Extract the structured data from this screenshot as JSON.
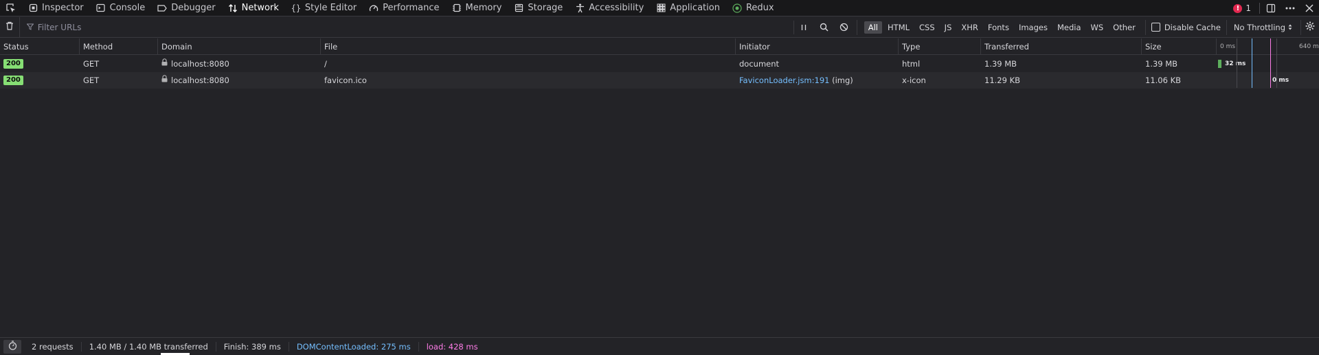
{
  "toolbar": {
    "tabs": [
      {
        "label": "Inspector",
        "icon": "inspector-icon"
      },
      {
        "label": "Console",
        "icon": "console-icon"
      },
      {
        "label": "Debugger",
        "icon": "debugger-icon"
      },
      {
        "label": "Network",
        "icon": "network-icon",
        "active": true
      },
      {
        "label": "Style Editor",
        "icon": "style-editor-icon"
      },
      {
        "label": "Performance",
        "icon": "performance-icon"
      },
      {
        "label": "Memory",
        "icon": "memory-icon"
      },
      {
        "label": "Storage",
        "icon": "storage-icon"
      },
      {
        "label": "Accessibility",
        "icon": "accessibility-icon"
      },
      {
        "label": "Application",
        "icon": "application-icon"
      },
      {
        "label": "Redux",
        "icon": "redux-icon"
      }
    ],
    "error_count": "1"
  },
  "filterbar": {
    "filter_placeholder": "Filter URLs",
    "types": [
      "All",
      "HTML",
      "CSS",
      "JS",
      "XHR",
      "Fonts",
      "Images",
      "Media",
      "WS",
      "Other"
    ],
    "active_type": "All",
    "disable_cache_label": "Disable Cache",
    "throttling_label": "No Throttling"
  },
  "table": {
    "columns": {
      "status": "Status",
      "method": "Method",
      "domain": "Domain",
      "file": "File",
      "initiator": "Initiator",
      "type": "Type",
      "transferred": "Transferred",
      "size": "Size"
    },
    "waterfall_ticks": [
      "0 ms",
      "640 ms"
    ],
    "rows": [
      {
        "status": "200",
        "method": "GET",
        "domain": "localhost:8080",
        "file": "/",
        "initiator": "document",
        "initiator_extra": "",
        "type": "html",
        "transferred": "1.39 MB",
        "size": "1.39 MB",
        "timing_label": "32 ms",
        "timing_ms": 32
      },
      {
        "status": "200",
        "method": "GET",
        "domain": "localhost:8080",
        "file": "favicon.ico",
        "initiator": "FaviconLoader.jsm:191",
        "initiator_extra": "(img)",
        "type": "x-icon",
        "transferred": "11.29 KB",
        "size": "11.06 KB",
        "timing_label": "0 ms",
        "timing_ms": 0
      }
    ]
  },
  "statusbar": {
    "requests": "2 requests",
    "transferred": "1.40 MB / 1.40 MB transferred",
    "finish": "Finish: 389 ms",
    "dom_content_loaded": "DOMContentLoaded: 275 ms",
    "load": "load: 428 ms"
  },
  "colors": {
    "status_ok": "#86de74",
    "dom_line": "#75bfff",
    "load_line": "#ff7de9",
    "error_badge": "#e22850"
  }
}
